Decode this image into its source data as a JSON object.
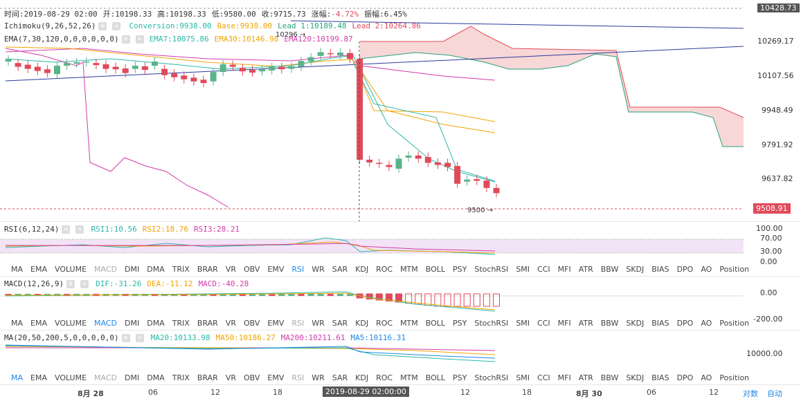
{
  "header": {
    "time_label": "时间:2019-08-29 02:00",
    "open_label": "开:10198.33",
    "high_label": "高:10198.33",
    "low_label": "低:9580.00",
    "close_label": "收:9715.73",
    "change_label": "涨幅:",
    "change_value": "-4.72%",
    "amplitude_label": "振幅:6.45%"
  },
  "ichimoku": {
    "name": "Ichimoku(9,26,52,26)",
    "conversion": "Conversion:9938.00",
    "base": "Base:9938.00",
    "lead1": "Lead 1:10189.48",
    "lead2": "Lead 2:10264.86"
  },
  "ema": {
    "name": "EMA(7,30,120,0,0,0,0,0,0)",
    "ema7": "EMA7:10075.86",
    "ema30": "EMA30:10146.98",
    "ema120": "EMA120:10199.87"
  },
  "annotations": {
    "high_marker": "10296 →",
    "low_marker": "9500 →"
  },
  "price_axis": {
    "labels": [
      "10428.73",
      "10269.17",
      "10107.56",
      "9948.49",
      "9791.92",
      "9637.82",
      "9508.91"
    ],
    "current_price": "9508.91"
  },
  "rsi": {
    "name": "RSI(6,12,24)",
    "rsi1": "RSI1:10.56",
    "rsi2": "RSI2:18.76",
    "rsi3": "RSI3:28.21",
    "axis": [
      "100.00",
      "70.00",
      "30.00",
      "0.00"
    ]
  },
  "macd": {
    "name": "MACD(12,26,9)",
    "dif": "DIF:-31.26",
    "dea": "DEA:-11.12",
    "macd": "MACD:-40.28",
    "axis": [
      "0.00",
      "-200.00"
    ]
  },
  "ma": {
    "name": "MA(20,50,200,5,0,0,0,0,0)",
    "ma20": "MA20:10133.98",
    "ma50": "MA50:10186.27",
    "ma200": "MA200:10211.61",
    "ma5": "MA5:10116.31",
    "axis": [
      "10000.00"
    ]
  },
  "indicator_tabs": [
    "MA",
    "EMA",
    "VOLUME",
    "MACD",
    "DMI",
    "DMA",
    "TRIX",
    "BRAR",
    "VR",
    "OBV",
    "EMV",
    "RSI",
    "WR",
    "SAR",
    "KDJ",
    "ROC",
    "MTM",
    "BOLL",
    "PSY",
    "StochRSI",
    "SMI",
    "CCI",
    "MFI",
    "ATR",
    "BBW",
    "SKDJ",
    "BIAS",
    "DPO",
    "AO",
    "Position"
  ],
  "time_axis": {
    "labels": [
      "8月 28",
      "06",
      "12",
      "18",
      "06",
      "12",
      "18",
      "8月 30",
      "06",
      "12"
    ],
    "cursor": "2019-08-29 02:00:00",
    "log_label": "对数",
    "auto_label": "自动"
  },
  "colors": {
    "up": "#5bb38a",
    "down": "#e04a5a",
    "accent": "#1e88e5"
  },
  "chart_data": {
    "type": "candlestick",
    "interval": "1h",
    "ylim": [
      9480,
      10440
    ],
    "candles_open_close": [
      [
        10185,
        10195
      ],
      [
        10178,
        10160
      ],
      [
        10170,
        10150
      ],
      [
        10160,
        10140
      ],
      [
        10148,
        10130
      ],
      [
        10125,
        10165
      ],
      [
        10165,
        10178
      ],
      [
        10175,
        10182
      ],
      [
        10180,
        10185
      ],
      [
        10178,
        10168
      ],
      [
        10172,
        10150
      ],
      [
        10160,
        10148
      ],
      [
        10152,
        10130
      ],
      [
        10150,
        10165
      ],
      [
        10162,
        10145
      ],
      [
        10165,
        10185
      ],
      [
        10150,
        10120
      ],
      [
        10128,
        10110
      ],
      [
        10118,
        10100
      ],
      [
        10108,
        10090
      ],
      [
        10098,
        10082
      ],
      [
        10090,
        10135
      ],
      [
        10135,
        10172
      ],
      [
        10170,
        10160
      ],
      [
        10155,
        10138
      ],
      [
        10145,
        10132
      ],
      [
        10138,
        10148
      ],
      [
        10142,
        10160
      ],
      [
        10160,
        10148
      ],
      [
        10150,
        10162
      ],
      [
        10160,
        10188
      ],
      [
        10186,
        10206
      ],
      [
        10212,
        10230
      ],
      [
        10225,
        10222
      ],
      [
        10215,
        10228
      ],
      [
        10226,
        10198
      ],
      [
        10198,
        9715
      ],
      [
        9715,
        9702
      ],
      [
        9700,
        9695
      ],
      [
        9690,
        9680
      ],
      [
        9672,
        9720
      ],
      [
        9725,
        9735
      ],
      [
        9735,
        9720
      ],
      [
        9728,
        9700
      ],
      [
        9702,
        9690
      ],
      [
        9700,
        9680
      ],
      [
        9685,
        9600
      ],
      [
        9610,
        9620
      ],
      [
        9622,
        9614
      ],
      [
        9615,
        9580
      ],
      [
        9580,
        9555
      ]
    ]
  }
}
